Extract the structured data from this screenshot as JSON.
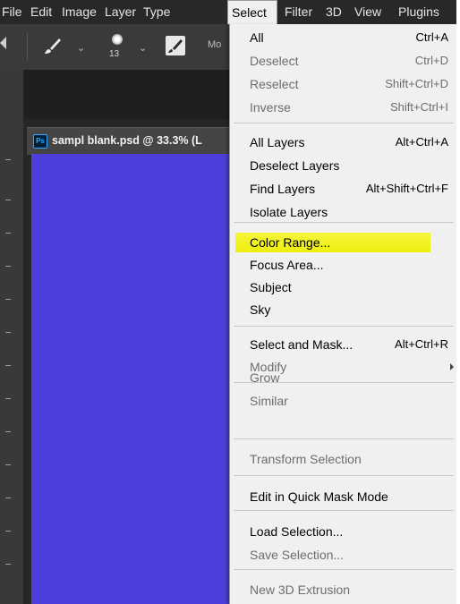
{
  "menubar": {
    "items": [
      "File",
      "Edit",
      "Image",
      "Layer",
      "Type",
      "Select",
      "Filter",
      "3D",
      "View",
      "Plugins"
    ],
    "active": "Select"
  },
  "options_bar": {
    "brush_size": "13",
    "mode_label": "Mo"
  },
  "document": {
    "tab_title": "sampl blank.psd @ 33.3% (L",
    "canvas_color": "#4d3fdc"
  },
  "select_menu": {
    "groups": [
      [
        {
          "label": "All",
          "shortcut": "Ctrl+A",
          "enabled": true
        },
        {
          "label": "Deselect",
          "shortcut": "Ctrl+D",
          "enabled": false
        },
        {
          "label": "Reselect",
          "shortcut": "Shift+Ctrl+D",
          "enabled": false
        },
        {
          "label": "Inverse",
          "shortcut": "Shift+Ctrl+I",
          "enabled": false
        }
      ],
      [
        {
          "label": "All Layers",
          "shortcut": "Alt+Ctrl+A",
          "enabled": true
        },
        {
          "label": "Deselect Layers",
          "shortcut": "",
          "enabled": true
        },
        {
          "label": "Find Layers",
          "shortcut": "Alt+Shift+Ctrl+F",
          "enabled": true
        },
        {
          "label": "Isolate Layers",
          "shortcut": "",
          "enabled": true
        }
      ],
      [
        {
          "label": "Color Range...",
          "shortcut": "",
          "enabled": true,
          "highlighted": true
        },
        {
          "label": "Focus Area...",
          "shortcut": "",
          "enabled": true
        },
        {
          "label": "Subject",
          "shortcut": "",
          "enabled": true
        },
        {
          "label": "Sky",
          "shortcut": "",
          "enabled": true
        }
      ],
      [
        {
          "label": "Select and Mask...",
          "shortcut": "Alt+Ctrl+R",
          "enabled": true
        },
        {
          "label": "Modify",
          "shortcut": "",
          "enabled": false,
          "submenu": true
        }
      ],
      [
        {
          "label": "Grow",
          "shortcut": "",
          "enabled": false
        },
        {
          "label": "Similar",
          "shortcut": "",
          "enabled": false
        }
      ],
      [
        {
          "label": "Transform Selection",
          "shortcut": "",
          "enabled": false
        }
      ],
      [
        {
          "label": "Edit in Quick Mask Mode",
          "shortcut": "",
          "enabled": true
        }
      ],
      [
        {
          "label": "Load Selection...",
          "shortcut": "",
          "enabled": true
        },
        {
          "label": "Save Selection...",
          "shortcut": "",
          "enabled": false
        }
      ],
      [
        {
          "label": "New 3D Extrusion",
          "shortcut": "",
          "enabled": false
        }
      ]
    ]
  },
  "colors": {
    "highlight": "#eeee10",
    "menu_bg": "#f0f0f0",
    "app_bg": "#2b2b2b"
  }
}
